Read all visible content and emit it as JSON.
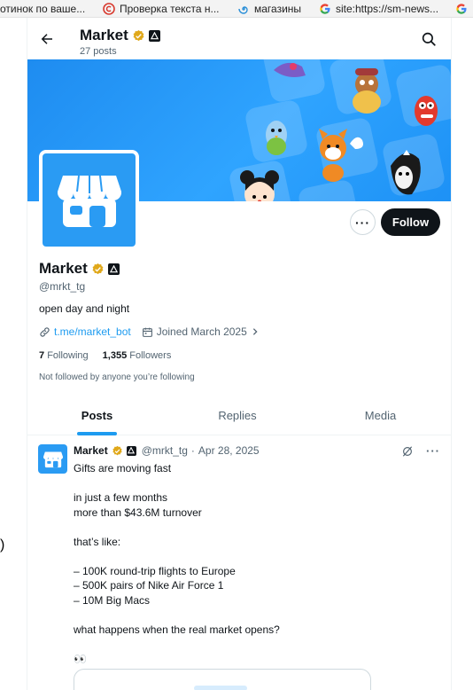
{
  "bookmarks": [
    {
      "label": "отинок по ваше...",
      "icon": "none"
    },
    {
      "label": "Проверка текста н...",
      "icon": "copyright-icon"
    },
    {
      "label": "магазины",
      "icon": "spiral-icon"
    },
    {
      "label": "site:https://sm-news...",
      "icon": "google-icon"
    },
    {
      "label": "",
      "icon": "google-icon"
    }
  ],
  "header": {
    "title": "Market",
    "posts_count": "27 posts"
  },
  "profile": {
    "name": "Market",
    "handle": "@mrkt_tg",
    "bio": "open day and night",
    "link": "t.me/market_bot",
    "joined": "Joined March 2025",
    "following_count": "7",
    "following_label": "Following",
    "followers_count": "1,355",
    "followers_label": "Followers",
    "not_followed": "Not followed by anyone you’re following",
    "follow_label": "Follow",
    "more_label": "···"
  },
  "tabs": [
    "Posts",
    "Replies",
    "Media"
  ],
  "post": {
    "name": "Market",
    "handle": "@mrkt_tg",
    "separator": "·",
    "date": "Apr 28, 2025",
    "more_label": "···",
    "lines": [
      "Gifts are moving fast",
      "",
      "in just a few months",
      "more than $43.6M turnover",
      "",
      "that’s like:",
      "",
      "– 100K round-trip flights to Europe",
      "– 500K pairs of Nike Air Force 1",
      "– 10M Big Macs",
      "",
      "what happens when the real market opens?",
      "",
      "👀"
    ]
  },
  "left_edge": ")",
  "colors": {
    "accent": "#1d9bf0",
    "brand": "#2a9bf3",
    "verified": "#e0a81a",
    "text": "#0f1419",
    "muted": "#536471"
  }
}
